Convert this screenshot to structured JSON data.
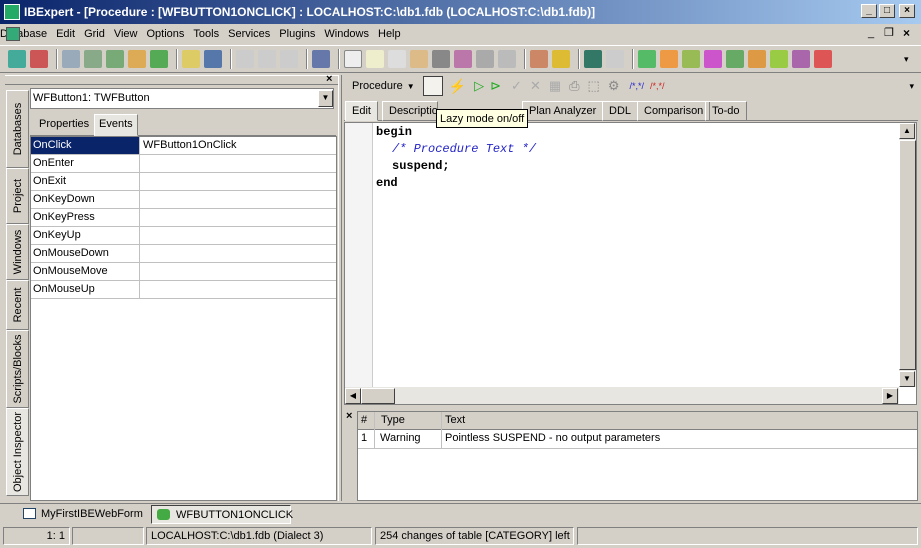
{
  "window": {
    "title": "IBExpert - [Procedure : [WFBUTTON1ONCLICK] : LOCALHOST:C:\\db1.fdb (LOCALHOST:C:\\db1.fdb)]"
  },
  "menu": [
    "Database",
    "Edit",
    "Grid",
    "View",
    "Options",
    "Tools",
    "Services",
    "Plugins",
    "Windows",
    "Help"
  ],
  "object_inspector": {
    "component": "WFButton1: TWFButton",
    "tabs": [
      "Properties",
      "Events"
    ],
    "events": [
      {
        "name": "OnClick",
        "value": "WFButton1OnClick"
      },
      {
        "name": "OnEnter",
        "value": ""
      },
      {
        "name": "OnExit",
        "value": ""
      },
      {
        "name": "OnKeyDown",
        "value": ""
      },
      {
        "name": "OnKeyPress",
        "value": ""
      },
      {
        "name": "OnKeyUp",
        "value": ""
      },
      {
        "name": "OnMouseDown",
        "value": ""
      },
      {
        "name": "OnMouseMove",
        "value": ""
      },
      {
        "name": "OnMouseUp",
        "value": ""
      }
    ]
  },
  "side_tabs": [
    "Databases",
    "Project",
    "Windows",
    "Recent",
    "Scripts/Blocks",
    "Object Inspector"
  ],
  "editor": {
    "dropdown_label": "Procedure",
    "tooltip": "Lazy mode on/off",
    "tabs": [
      "Edit",
      "Descriptio",
      "P...",
      "Plan Analyzer",
      "DDL",
      "Comparison",
      "To-do"
    ],
    "code_lines": [
      "begin",
      "/* Procedure Text */",
      "suspend;",
      "end"
    ]
  },
  "messages": {
    "headers": [
      "#",
      "Type",
      "Text"
    ],
    "rows": [
      {
        "num": "1",
        "type": "Warning",
        "text": "Pointless SUSPEND - no output parameters"
      }
    ]
  },
  "taskbar": [
    "MyFirstIBEWebForm",
    "WFBUTTON1ONCLICK"
  ],
  "status": {
    "position": "1:   1",
    "connection": "LOCALHOST:C:\\db1.fdb (Dialect 3)",
    "message": "254 changes of table [CATEGORY] left"
  }
}
